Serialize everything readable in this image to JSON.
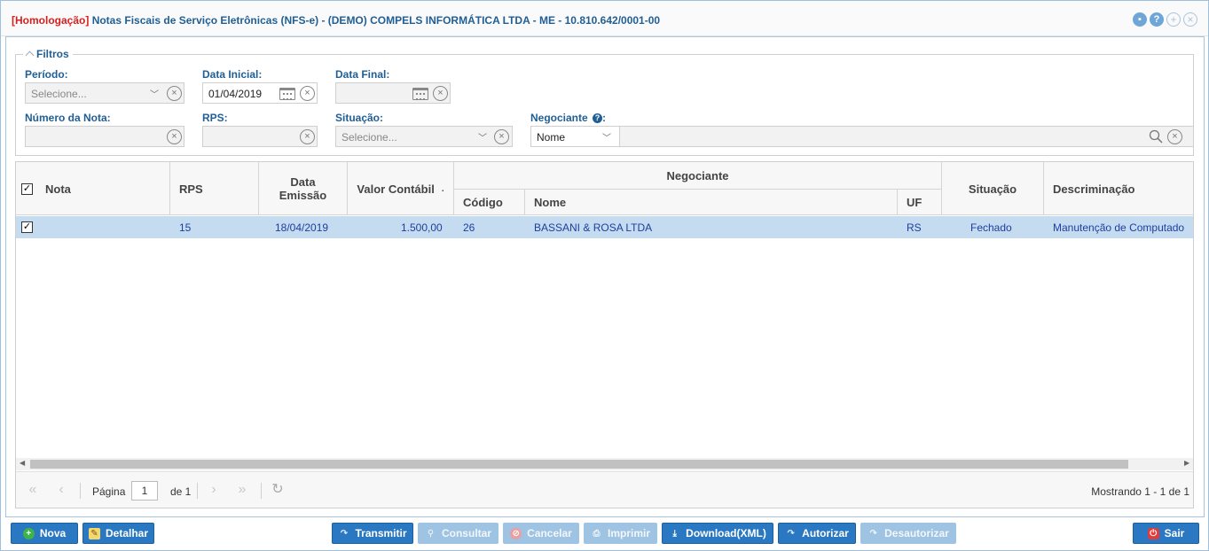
{
  "window": {
    "title_prefix": "[Homologação]",
    "title": "Notas Fiscais de Serviço Eletrônicas (NFS-e) - (DEMO) COMPELS INFORMÁTICA LTDA - ME - 10.810.642/0001-00"
  },
  "filters": {
    "legend": "Filtros",
    "periodo": {
      "label": "Período:",
      "placeholder": "Selecione..."
    },
    "data_inicial": {
      "label": "Data Inicial:",
      "value": "01/04/2019"
    },
    "data_final": {
      "label": "Data Final:",
      "value": ""
    },
    "numero_nota": {
      "label": "Número da Nota:",
      "value": ""
    },
    "rps": {
      "label": "RPS:",
      "value": ""
    },
    "situacao": {
      "label": "Situação:",
      "placeholder": "Selecione..."
    },
    "negociante": {
      "label": "Negociante",
      "mode": "Nome",
      "value": ""
    }
  },
  "grid": {
    "columns": {
      "nota": "Nota",
      "rps": "RPS",
      "data_emissao": "Data Emissão",
      "valor_contabil": "Valor Contábil",
      "negociante": "Negociante",
      "codigo": "Código",
      "nome": "Nome",
      "uf": "UF",
      "situacao": "Situação",
      "descriminacao": "Descriminação"
    },
    "rows": [
      {
        "checked": true,
        "nota": "",
        "rps": "15",
        "data_emissao": "18/04/2019",
        "valor_contabil": "1.500,00",
        "codigo": "26",
        "nome": "BASSANI & ROSA LTDA",
        "uf": "RS",
        "situacao": "Fechado",
        "descriminacao": "Manutenção de Computado"
      }
    ]
  },
  "pager": {
    "page_label": "Página",
    "page": "1",
    "of_label": "de 1",
    "summary": "Mostrando 1 - 1 de 1"
  },
  "toolbar": {
    "nova": "Nova",
    "detalhar": "Detalhar",
    "transmitir": "Transmitir",
    "consultar": "Consultar",
    "cancelar": "Cancelar",
    "imprimir": "Imprimir",
    "download": "Download(XML)",
    "autorizar": "Autorizar",
    "desautorizar": "Desautorizar",
    "sair": "Sair"
  },
  "colors": {
    "accent": "#2a78c2",
    "title": "#1f5f95",
    "homologacao": "#d62020",
    "row_selected": "#c5dcf0"
  }
}
